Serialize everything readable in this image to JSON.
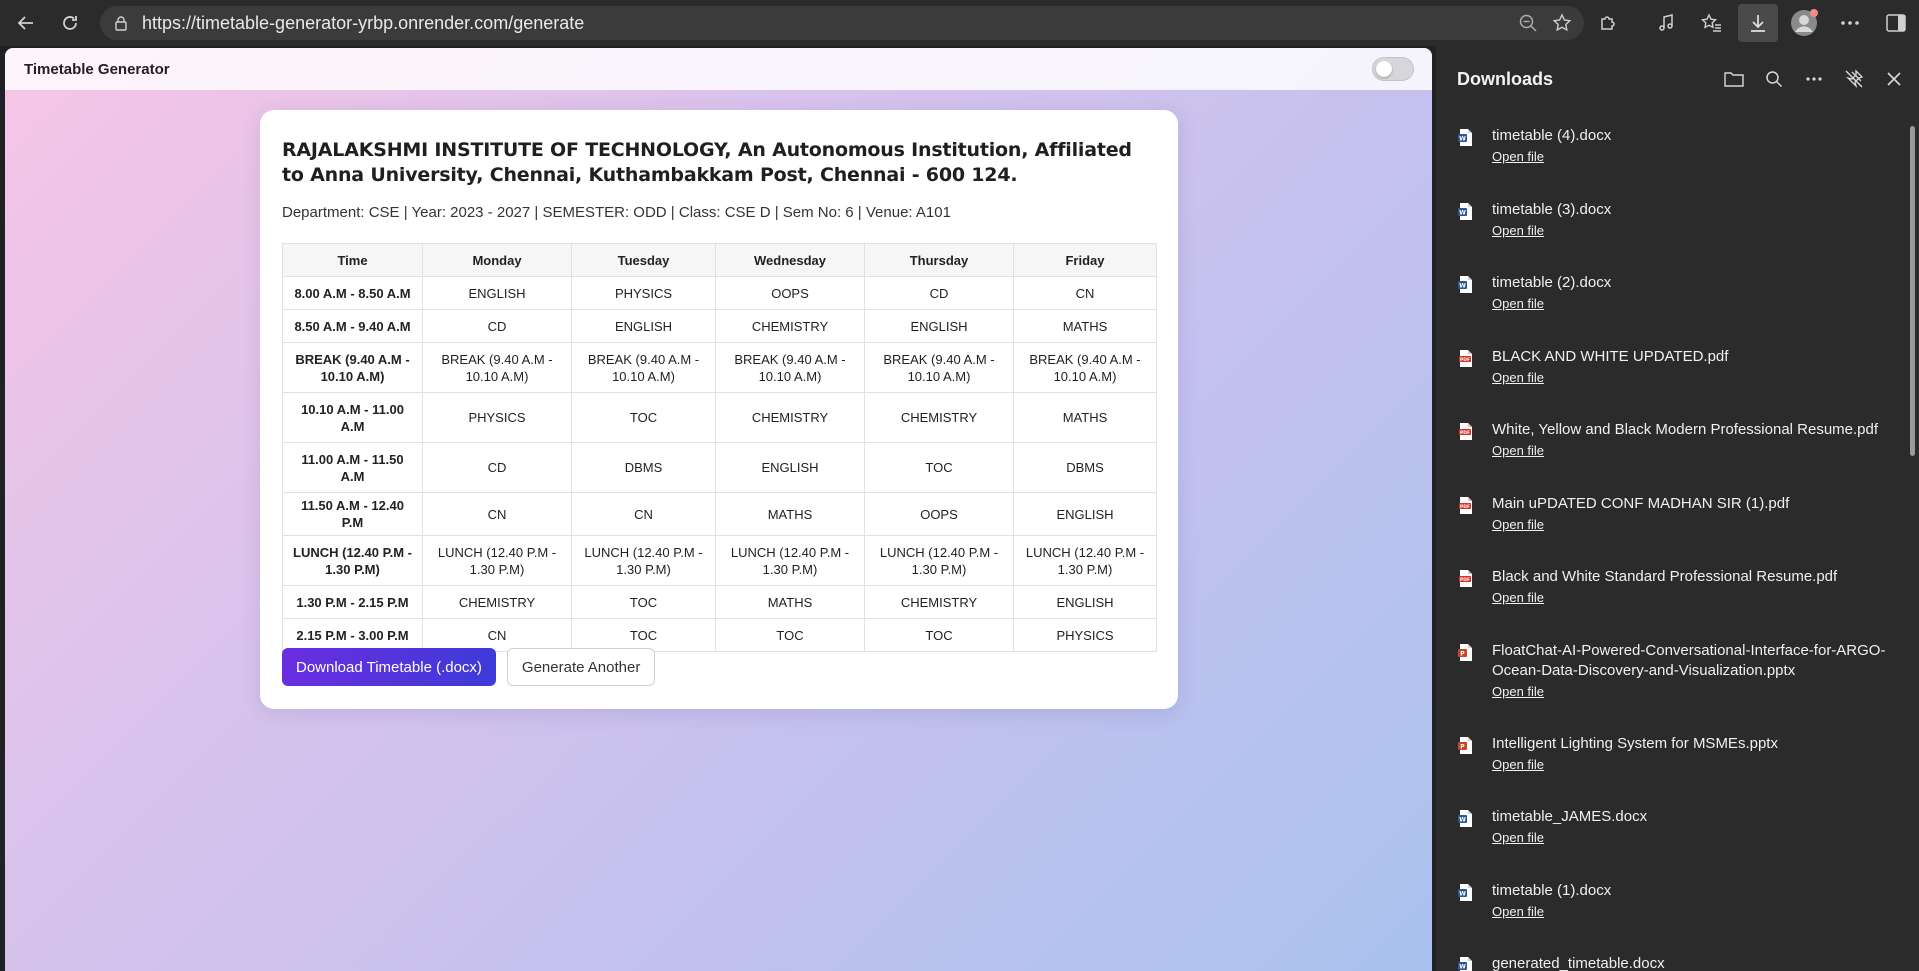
{
  "browser": {
    "url": "https://timetable-generator-yrbp.onrender.com/generate"
  },
  "app": {
    "title": "Timetable Generator"
  },
  "card": {
    "institution": "RAJALAKSHMI INSTITUTE OF TECHNOLOGY, An Autonomous Institution, Affiliated to Anna University, Chennai, Kuthambakkam Post, Chennai - 600 124.",
    "meta": "Department: CSE | Year: 2023 - 2027 | SEMESTER: ODD | Class: CSE D | Sem No: 6 | Venue: A101",
    "columns": [
      "Time",
      "Monday",
      "Tuesday",
      "Wednesday",
      "Thursday",
      "Friday"
    ],
    "rows": [
      [
        "8.00 A.M - 8.50 A.M",
        "ENGLISH",
        "PHYSICS",
        "OOPS",
        "CD",
        "CN"
      ],
      [
        "8.50 A.M - 9.40 A.M",
        "CD",
        "ENGLISH",
        "CHEMISTRY",
        "ENGLISH",
        "MATHS"
      ],
      [
        "BREAK (9.40 A.M - 10.10 A.M)",
        "BREAK (9.40 A.M - 10.10 A.M)",
        "BREAK (9.40 A.M - 10.10 A.M)",
        "BREAK (9.40 A.M - 10.10 A.M)",
        "BREAK (9.40 A.M - 10.10 A.M)",
        "BREAK (9.40 A.M - 10.10 A.M)"
      ],
      [
        "10.10 A.M - 11.00 A.M",
        "PHYSICS",
        "TOC",
        "CHEMISTRY",
        "CHEMISTRY",
        "MATHS"
      ],
      [
        "11.00 A.M - 11.50 A.M",
        "CD",
        "DBMS",
        "ENGLISH",
        "TOC",
        "DBMS"
      ],
      [
        "11.50 A.M - 12.40 P.M",
        "CN",
        "CN",
        "MATHS",
        "OOPS",
        "ENGLISH"
      ],
      [
        "LUNCH (12.40 P.M - 1.30 P.M)",
        "LUNCH (12.40 P.M - 1.30 P.M)",
        "LUNCH (12.40 P.M - 1.30 P.M)",
        "LUNCH (12.40 P.M - 1.30 P.M)",
        "LUNCH (12.40 P.M - 1.30 P.M)",
        "LUNCH (12.40 P.M - 1.30 P.M)"
      ],
      [
        "1.30 P.M - 2.15 P.M",
        "CHEMISTRY",
        "TOC",
        "MATHS",
        "CHEMISTRY",
        "ENGLISH"
      ],
      [
        "2.15 P.M - 3.00 P.M",
        "CN",
        "TOC",
        "TOC",
        "TOC",
        "PHYSICS"
      ]
    ],
    "download_label": "Download Timetable (.docx)",
    "generate_label": "Generate Another"
  },
  "downloads": {
    "title": "Downloads",
    "open_label": "Open file",
    "items": [
      {
        "name": "timetable (4).docx",
        "type": "docx"
      },
      {
        "name": "timetable (3).docx",
        "type": "docx"
      },
      {
        "name": "timetable (2).docx",
        "type": "docx"
      },
      {
        "name": "BLACK AND WHITE UPDATED.pdf",
        "type": "pdf"
      },
      {
        "name": "White, Yellow and Black Modern Professional Resume.pdf",
        "type": "pdf"
      },
      {
        "name": "Main uPDATED CONF MADHAN SIR (1).pdf",
        "type": "pdf"
      },
      {
        "name": "Black and White Standard Professional Resume.pdf",
        "type": "pdf"
      },
      {
        "name": "FloatChat-AI-Powered-Conversational-Interface-for-ARGO-Ocean-Data-Discovery-and-Visualization.pptx",
        "type": "pptx"
      },
      {
        "name": "Intelligent Lighting System for MSMEs.pptx",
        "type": "pptx"
      },
      {
        "name": "timetable_JAMES.docx",
        "type": "docx"
      },
      {
        "name": "timetable (1).docx",
        "type": "docx"
      },
      {
        "name": "generated_timetable.docx",
        "type": "docx"
      }
    ]
  },
  "colors": {
    "accent": "#5b34de",
    "docx": "#2b5797",
    "pdf": "#d93025",
    "pptx": "#c4472b"
  }
}
